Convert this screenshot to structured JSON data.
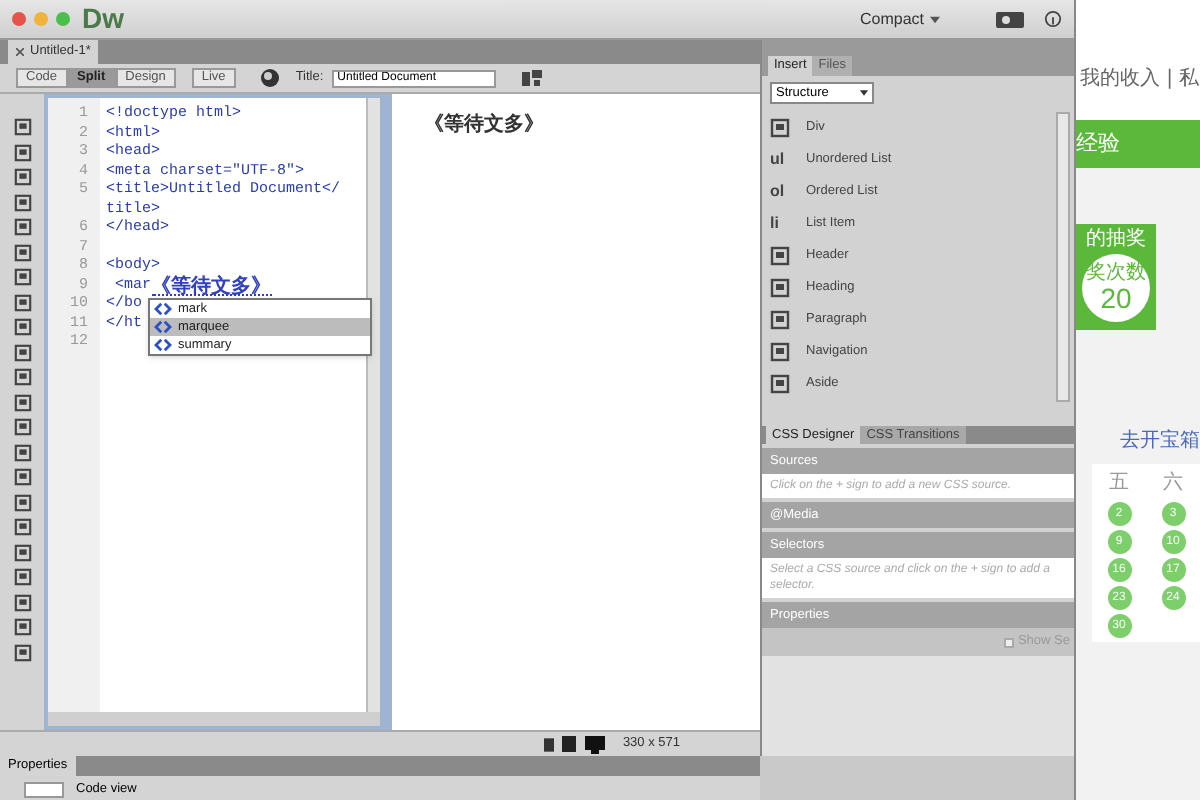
{
  "window": {
    "app_name": "Dw",
    "workspace": "Compact"
  },
  "document_tab": {
    "title": "Untitled-1*"
  },
  "view_buttons": [
    {
      "label": "Code",
      "selected": false
    },
    {
      "label": "Split",
      "selected": true
    },
    {
      "label": "Design",
      "selected": false
    },
    {
      "label": "Live",
      "selected": false
    }
  ],
  "title_field": {
    "label": "Title:",
    "value": "Untitled Document"
  },
  "code_lines": [
    {
      "number": "1",
      "text": "<!doctype html>"
    },
    {
      "number": "2",
      "text": "<html>"
    },
    {
      "number": "3",
      "text": "<head>"
    },
    {
      "number": "4",
      "text": "<meta charset=\"UTF-8\">"
    },
    {
      "number": "5",
      "text": "<title>Untitled Document</"
    },
    {
      "text": "title>"
    },
    {
      "number": "6",
      "text": "</head>"
    },
    {
      "number": "7"
    },
    {
      "number": "8",
      "text": "<body>"
    },
    {
      "number": "9",
      "text": " <mar",
      "ime_text": "《等待文多》"
    },
    {
      "number": "10",
      "text": "</bo"
    },
    {
      "number": "11",
      "text": "</ht"
    },
    {
      "number": "12"
    }
  ],
  "autocomplete": [
    {
      "label": "mark",
      "selected": false
    },
    {
      "label": "marquee",
      "selected": true
    },
    {
      "label": "summary",
      "selected": false
    }
  ],
  "design_view": {
    "text": "《等待文多》"
  },
  "status_bar": {
    "size": "330 x 571"
  },
  "properties_panel": {
    "title": "Properties",
    "label": "Code view"
  },
  "insert_panel": {
    "tabs": [
      {
        "label": "Insert",
        "selected": true
      },
      {
        "label": "Files",
        "selected": false
      }
    ],
    "category": "Structure",
    "items": [
      {
        "label": "Div"
      },
      {
        "label": "Unordered List",
        "glyph": "ul"
      },
      {
        "label": "Ordered List",
        "glyph": "ol"
      },
      {
        "label": "List Item",
        "glyph": "li"
      },
      {
        "label": "Header"
      },
      {
        "label": "Heading"
      },
      {
        "label": "Paragraph"
      },
      {
        "label": "Navigation"
      },
      {
        "label": "Aside"
      }
    ]
  },
  "css_panel": {
    "tabs": [
      {
        "label": "CSS Designer",
        "selected": true
      },
      {
        "label": "CSS Transitions",
        "selected": false
      }
    ],
    "sections": [
      {
        "title": "Sources",
        "hint": "Click on the + sign to add a new CSS source."
      },
      {
        "title": "@Media"
      },
      {
        "title": "Selectors",
        "hint": "Select a CSS source and click on the + sign to add a selector."
      },
      {
        "title": "Properties"
      }
    ],
    "show_set": {
      "label": "Show Se",
      "checked": false
    }
  },
  "background_page": {
    "header_text": "我的收入 | 私",
    "banner": "经验",
    "card_title": "的抽奖",
    "card_label": "奖次数",
    "card_count": "20",
    "link": "去开宝箱",
    "weekdays": [
      "五",
      "六"
    ],
    "days": [
      "2",
      "3",
      "9",
      "10",
      "16",
      "17",
      "23",
      "24",
      "30"
    ]
  }
}
